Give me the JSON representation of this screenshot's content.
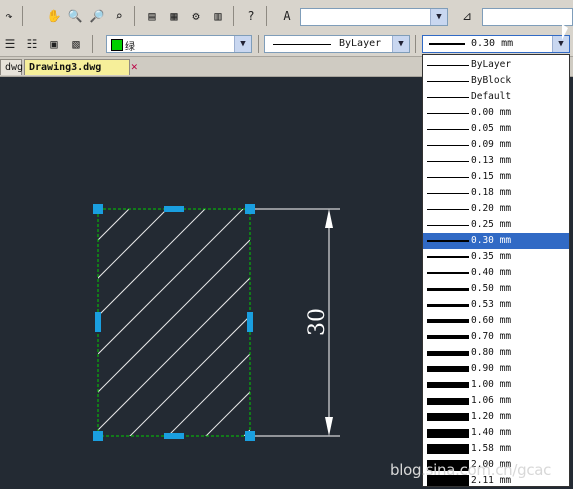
{
  "tabs": [
    {
      "label": "dwg"
    },
    {
      "label": "Drawing3.dwg"
    }
  ],
  "toolbar": {
    "color_value": "绿",
    "color_swatch": "#00d000",
    "linetype_value": "ByLayer",
    "lineweight_value": "0.30 mm"
  },
  "lineweight_dropdown": {
    "selected": "0.30 mm",
    "items": [
      "ByLayer",
      "ByBlock",
      "Default",
      "0.00 mm",
      "0.05 mm",
      "0.09 mm",
      "0.13 mm",
      "0.15 mm",
      "0.18 mm",
      "0.20 mm",
      "0.25 mm",
      "0.30 mm",
      "0.35 mm",
      "0.40 mm",
      "0.50 mm",
      "0.53 mm",
      "0.60 mm",
      "0.70 mm",
      "0.80 mm",
      "0.90 mm",
      "1.00 mm",
      "1.06 mm",
      "1.20 mm",
      "1.40 mm",
      "1.58 mm",
      "2.00 mm",
      "2.11 mm"
    ]
  },
  "drawing": {
    "dimension_text": "30",
    "grip_color": "#1a9fe0",
    "selection_color": "#00cc00"
  },
  "watermark": "blog.sina.com.cn/gcac"
}
